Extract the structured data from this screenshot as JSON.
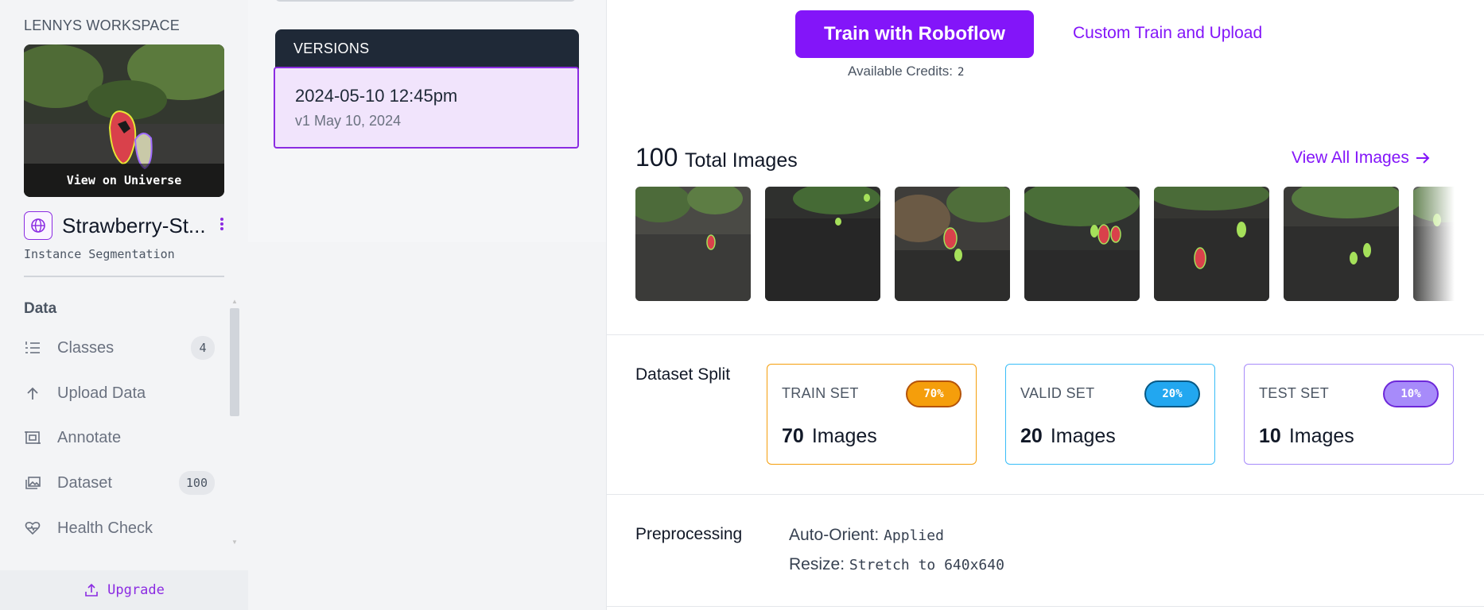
{
  "sidebar": {
    "workspace_name": "LENNYS WORKSPACE",
    "universe_label": "View on Universe",
    "project_name": "Strawberry-St...",
    "project_type": "Instance Segmentation",
    "section_title": "Data",
    "nav": [
      {
        "label": "Classes",
        "icon": "list-icon",
        "count": "4"
      },
      {
        "label": "Upload Data",
        "icon": "upload-arrow-icon",
        "count": ""
      },
      {
        "label": "Annotate",
        "icon": "annotate-icon",
        "count": ""
      },
      {
        "label": "Dataset",
        "icon": "images-stack-icon",
        "count": "100"
      },
      {
        "label": "Health Check",
        "icon": "heart-pulse-icon",
        "count": ""
      }
    ],
    "upgrade_label": "Upgrade"
  },
  "versions": {
    "header": "VERSIONS",
    "items": [
      {
        "title": "2024-05-10 12:45pm",
        "subtitle": "v1 May 10, 2024"
      }
    ]
  },
  "main": {
    "train_button": "Train with Roboflow",
    "custom_link": "Custom Train and Upload",
    "credits_label": "Available Credits:",
    "credits_value": "2",
    "total_count": "100",
    "total_label": "Total Images",
    "view_all": "View All Images",
    "dataset_split_label": "Dataset Split",
    "splits": [
      {
        "title": "TRAIN SET",
        "pct": "70%",
        "count": "70",
        "unit": "Images",
        "color": "#f59e0b",
        "badge": "#f59e0b"
      },
      {
        "title": "VALID SET",
        "pct": "20%",
        "count": "20",
        "unit": "Images",
        "color": "#38bdf8",
        "badge": "#22a7f0"
      },
      {
        "title": "TEST SET",
        "pct": "10%",
        "count": "10",
        "unit": "Images",
        "color": "#a78bfa",
        "badge": "#a78bfa"
      }
    ],
    "preprocessing_label": "Preprocessing",
    "preprocessing": [
      {
        "key": "Auto-Orient:",
        "value": "Applied"
      },
      {
        "key": "Resize:",
        "value": "Stretch to 640x640"
      }
    ]
  },
  "colors": {
    "accent": "#8315f9",
    "nav_text": "#6b7280",
    "versions_header": "#1f2937",
    "selected_version_bg": "#f1e4fc"
  }
}
